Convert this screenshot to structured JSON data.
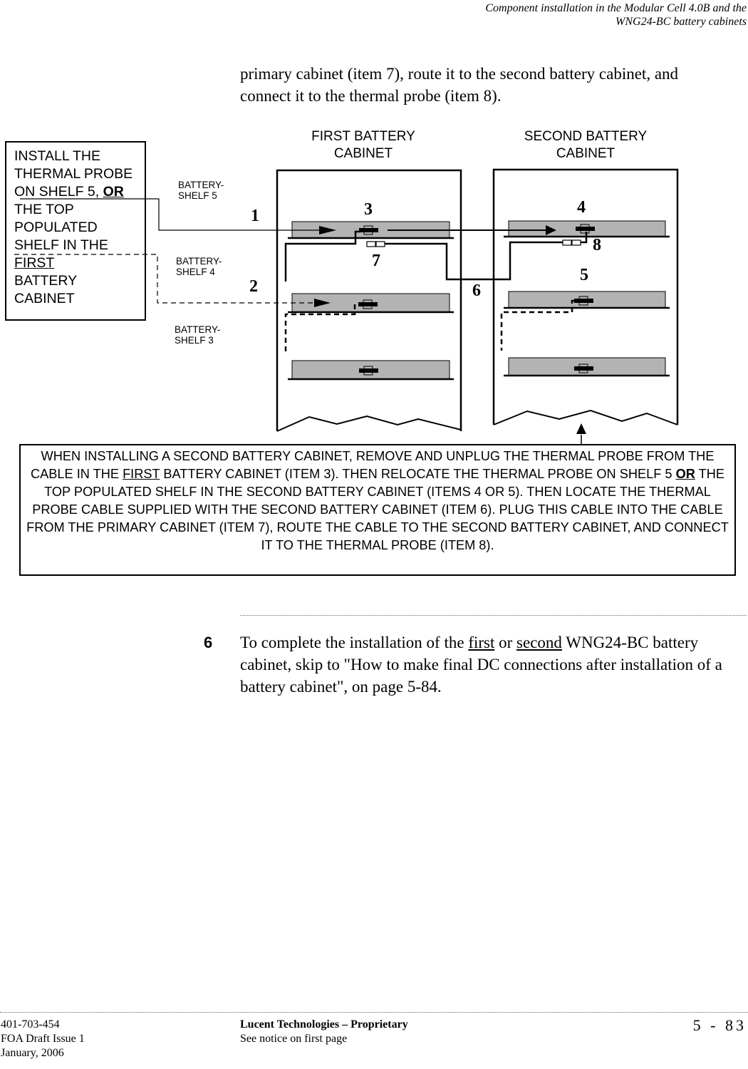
{
  "header": {
    "line1": "Component installation in the Modular Cell 4.0B and the",
    "line2": "WNG24-BC battery cabinets"
  },
  "intro_paragraph": {
    "line1": "primary cabinet (item 7), route it to the second battery cabinet, and",
    "line2": "connect it to the thermal probe (item 8)."
  },
  "diagram": {
    "first_cabinet_title": [
      "FIRST BATTERY",
      "CABINET"
    ],
    "second_cabinet_title": [
      "SECOND BATTERY",
      "CABINET"
    ],
    "shelf_labels": [
      {
        "line1": "BATTERY-",
        "line2": "SHELF 5"
      },
      {
        "line1": "BATTERY-",
        "line2": "SHELF 4"
      },
      {
        "line1": "BATTERY-",
        "line2": "SHELF 3"
      }
    ],
    "item_numbers": [
      "1",
      "2",
      "3",
      "4",
      "5",
      "6",
      "7",
      "8"
    ],
    "install_box": {
      "lines": [
        "INSTALL THE",
        "THERMAL PROBE",
        "ON SHELF 5, ",
        "OR",
        "THE TOP",
        "POPULATED",
        "SHELF IN THE",
        "FIRST",
        "BATTERY",
        "CABINET"
      ]
    },
    "note_box": {
      "part1": "WHEN INSTALLING A SECOND BATTERY CABINET, REMOVE AND UNPLUG THE THERMAL PROBE FROM THE CABLE IN THE ",
      "first": "FIRST",
      "part2": " BATTERY CABINET (ITEM 3). THEN RELOCATE THE THERMAL PROBE ON SHELF 5 ",
      "or": "OR",
      "part3": " THE TOP POPULATED SHELF IN THE SECOND BATTERY CABINET (ITEMS 4 OR 5). THEN LOCATE THE THERMAL PROBE CABLE SUPPLIED WITH THE SECOND BATTERY CABINET (ITEM 6). PLUG THIS CABLE INTO THE CABLE FROM THE PRIMARY CABINET (ITEM 7), ROUTE THE CABLE TO THE SECOND BATTERY CABINET, AND CONNECT IT TO THE THERMAL PROBE (ITEM 8)."
    },
    "colors": {
      "shelf_fill": "#b3b3b3",
      "line": "#000000"
    }
  },
  "step": {
    "number": "6",
    "text1": "To complete the installation of the ",
    "first": "first",
    "text2": " or ",
    "second": "second",
    "text3": " WNG24-BC battery cabinet, skip to \"How to make final DC connections after installation of a battery cabinet\", on page 5-84."
  },
  "footer": {
    "doc_number": "401-703-454",
    "issue": "FOA Draft Issue 1",
    "date": "January, 2006",
    "company": "Lucent Technologies – Proprietary",
    "notice": "See notice on first page",
    "page": "5 - 83"
  }
}
